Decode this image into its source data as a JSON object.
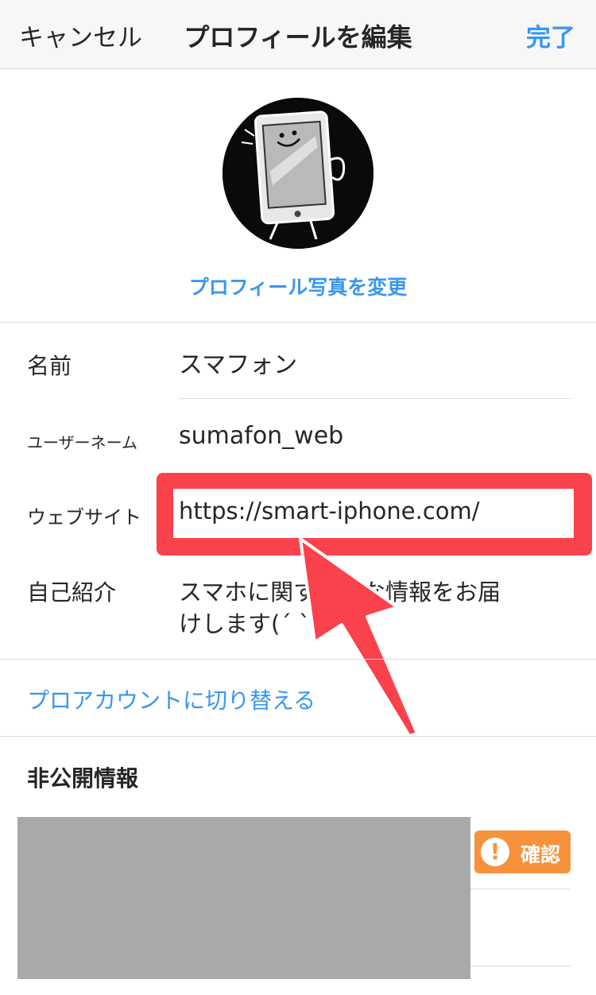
{
  "nav": {
    "cancel": "キャンセル",
    "title": "プロフィールを編集",
    "done": "完了"
  },
  "profile": {
    "change_photo": "プロフィール写真を変更"
  },
  "fields": {
    "name": {
      "label": "名前",
      "value": "スマフォン"
    },
    "username": {
      "label": "ユーザーネーム",
      "value": "sumafon_web"
    },
    "website": {
      "label": "ウェブサイト",
      "value": "https://smart-iphone.com/"
    },
    "bio": {
      "label": "自己紹介",
      "line1": "スマホに関する得な情報をお届",
      "line2": "けします(´ `)"
    }
  },
  "pro_account": "プロアカウントに切り替える",
  "private_info": {
    "heading": "非公開情報",
    "confirm": "確認"
  },
  "colors": {
    "accent": "#3897f0",
    "highlight": "#f9424b",
    "warning": "#f6923b"
  }
}
